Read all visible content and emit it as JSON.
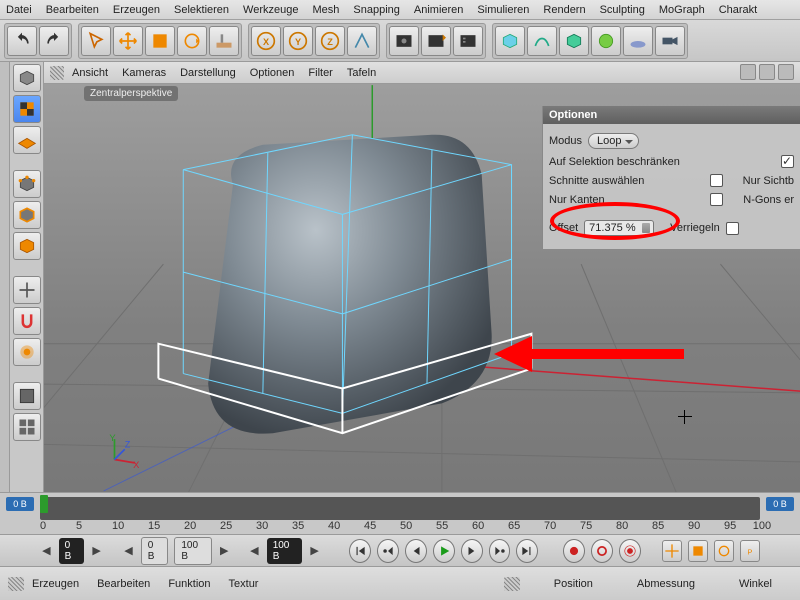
{
  "menubar": [
    "Datei",
    "Bearbeiten",
    "Erzeugen",
    "Selektieren",
    "Werkzeuge",
    "Mesh",
    "Snapping",
    "Animieren",
    "Simulieren",
    "Rendern",
    "Sculpting",
    "MoGraph",
    "Charakt"
  ],
  "view_menu": [
    "Ansicht",
    "Kameras",
    "Darstellung",
    "Optionen",
    "Filter",
    "Tafeln"
  ],
  "view_tag": "Zentralperspektive",
  "options_panel": {
    "title": "Optionen",
    "modus_label": "Modus",
    "modus_value": "Loop",
    "restrict_label": "Auf Selektion beschränken",
    "select_cuts_label": "Schnitte auswählen",
    "only_visible_label": "Nur Sichtb",
    "only_edges_label": "Nur Kanten",
    "ngons_label": "N-Gons er",
    "offset_label": "Offset",
    "offset_value": "71.375 %",
    "lock_label": "Verriegeln"
  },
  "timeline": {
    "start": "0 B",
    "ticks": [
      "0",
      "5",
      "10",
      "15",
      "20",
      "25",
      "30",
      "35",
      "40",
      "45",
      "50",
      "55",
      "60",
      "65",
      "70",
      "75",
      "80",
      "85",
      "90",
      "95",
      "100"
    ]
  },
  "playbar": {
    "cur": "0 B",
    "range_from": "0 B",
    "range_to": "100 B",
    "range_to2": "100 B"
  },
  "bottom_tabs_left": [
    "Erzeugen",
    "Bearbeiten",
    "Funktion",
    "Textur"
  ],
  "bottom_tabs_right": [
    "Position",
    "Abmessung",
    "Winkel"
  ]
}
